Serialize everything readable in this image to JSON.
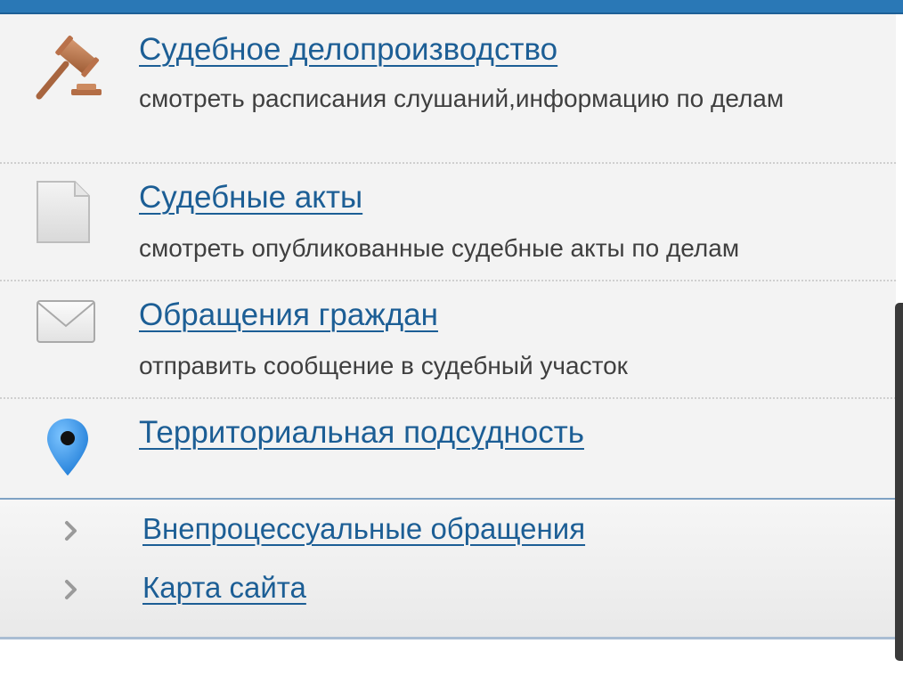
{
  "menu": {
    "items": [
      {
        "title": "Судебное делопроизводство",
        "description": "смотреть расписания слушаний,информацию по делам",
        "icon": "gavel-icon"
      },
      {
        "title": "Судебные акты",
        "description": "смотреть опубликованные судебные акты по делам",
        "icon": "document-icon"
      },
      {
        "title": "Обращения граждан",
        "description": "отправить сообщение в судебный участок",
        "icon": "envelope-icon"
      },
      {
        "title": "Территориальная подсудность",
        "description": "",
        "icon": "map-pin-icon"
      }
    ]
  },
  "footer": {
    "links": [
      {
        "label": "Внепроцессуальные обращения",
        "icon": "chevron-right-icon"
      },
      {
        "label": "Карта сайта",
        "icon": "chevron-right-icon"
      }
    ]
  },
  "colors": {
    "link": "#1c5e95",
    "header_bar": "#2a78b6",
    "description_text": "#3f3f3f",
    "panel_background": "#f3f3f3"
  }
}
